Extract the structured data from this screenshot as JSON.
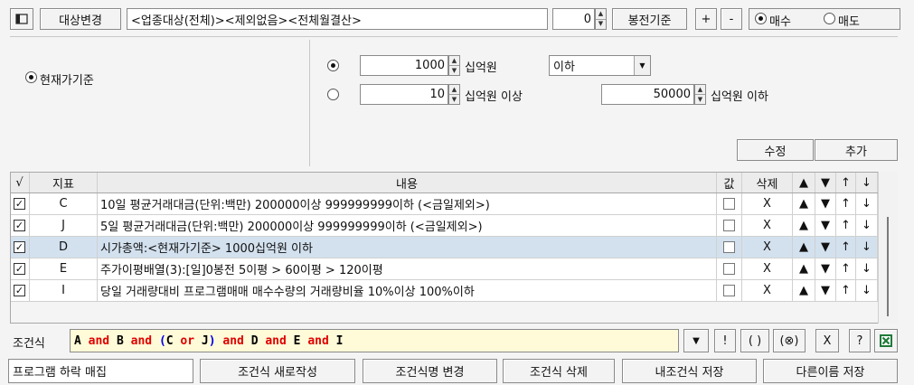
{
  "toolbar": {
    "target_change_label": "대상변경",
    "target_text": "<업종대상(전체)><제외없음><전체월결산>",
    "count_value": "0",
    "bong_label": "봉전기준",
    "plus_label": "+",
    "minus_label": "-",
    "buy_label": "매수",
    "sell_label": "매도",
    "buy_selected": true
  },
  "condition": {
    "mode_label": "현재가기준",
    "row1": {
      "value": "1000",
      "unit": "십억원",
      "compare": "이하"
    },
    "row2": {
      "min_value": "10",
      "min_unit": "십억원 이상",
      "max_value": "50000",
      "max_unit": "십억원 이하"
    },
    "modify_label": "수정",
    "add_label": "추가"
  },
  "table": {
    "headers": {
      "check": "√",
      "indicator": "지표",
      "content": "내용",
      "value": "값",
      "delete": "삭제",
      "up_fill": "▲",
      "down_fill": "▼",
      "up": "↑",
      "down": "↓"
    },
    "rows": [
      {
        "checked": true,
        "indicator": "C",
        "content": "10일 평균거래대금(단위:백만) 200000이상 999999999이하 (<금일제외>)",
        "delete": "X",
        "up_fill": "▲",
        "down_fill": "▼",
        "up": "↑",
        "down": "↓"
      },
      {
        "checked": true,
        "indicator": "J",
        "content": "5일 평균거래대금(단위:백만) 200000이상 999999999이하 (<금일제외>)",
        "delete": "X",
        "up_fill": "▲",
        "down_fill": "▼",
        "up": "↑",
        "down": "↓"
      },
      {
        "checked": true,
        "indicator": "D",
        "content": "시가총액:<현재가기준> 1000십억원 이하",
        "delete": "X",
        "up_fill": "▲",
        "down_fill": "▼",
        "up": "↑",
        "down": "↓",
        "selected": true
      },
      {
        "checked": true,
        "indicator": "E",
        "content": "주가이평배열(3):[일]0봉전 5이평 > 60이평 > 120이평",
        "delete": "X",
        "up_fill": "▲",
        "down_fill": "▼",
        "up": "↑",
        "down": "↓"
      },
      {
        "checked": true,
        "indicator": "I",
        "content": "당일 거래량대비 프로그램매매 매수수량의 거래량비율 10%이상 100%이하",
        "delete": "X",
        "up_fill": "▲",
        "down_fill": "▼",
        "up": "↑",
        "down": "↓"
      }
    ]
  },
  "formula": {
    "label": "조건식",
    "tokens": [
      {
        "text": "A",
        "color": "#000000"
      },
      {
        "text": " and ",
        "color": "#e00000"
      },
      {
        "text": "B",
        "color": "#000000"
      },
      {
        "text": " and ",
        "color": "#e00000"
      },
      {
        "text": "(",
        "color": "#0000ee"
      },
      {
        "text": "C",
        "color": "#000000"
      },
      {
        "text": " or ",
        "color": "#e00000"
      },
      {
        "text": "J",
        "color": "#000000"
      },
      {
        "text": ")",
        "color": "#0000ee"
      },
      {
        "text": " and ",
        "color": "#e00000"
      },
      {
        "text": "D",
        "color": "#000000"
      },
      {
        "text": " and ",
        "color": "#e00000"
      },
      {
        "text": "E",
        "color": "#000000"
      },
      {
        "text": " and ",
        "color": "#e00000"
      },
      {
        "text": "I",
        "color": "#000000"
      }
    ],
    "buttons": {
      "dropdown": "▼",
      "not": "!",
      "paren": "( )",
      "otimes": "(⊗)",
      "x": "X",
      "help": "?"
    }
  },
  "bottom": {
    "name_value": "프로그램 하락 매집",
    "new_label": "조건식 새로작성",
    "rename_label": "조건식명 변경",
    "delete_label": "조건식 삭제",
    "save_label": "내조건식 저장",
    "save_as_label": "다른이름 저장"
  },
  "colors": {
    "excel_green": "#1f7a3a",
    "selected_row": "#d3e1ef",
    "formula_bg": "#fffbd8"
  }
}
